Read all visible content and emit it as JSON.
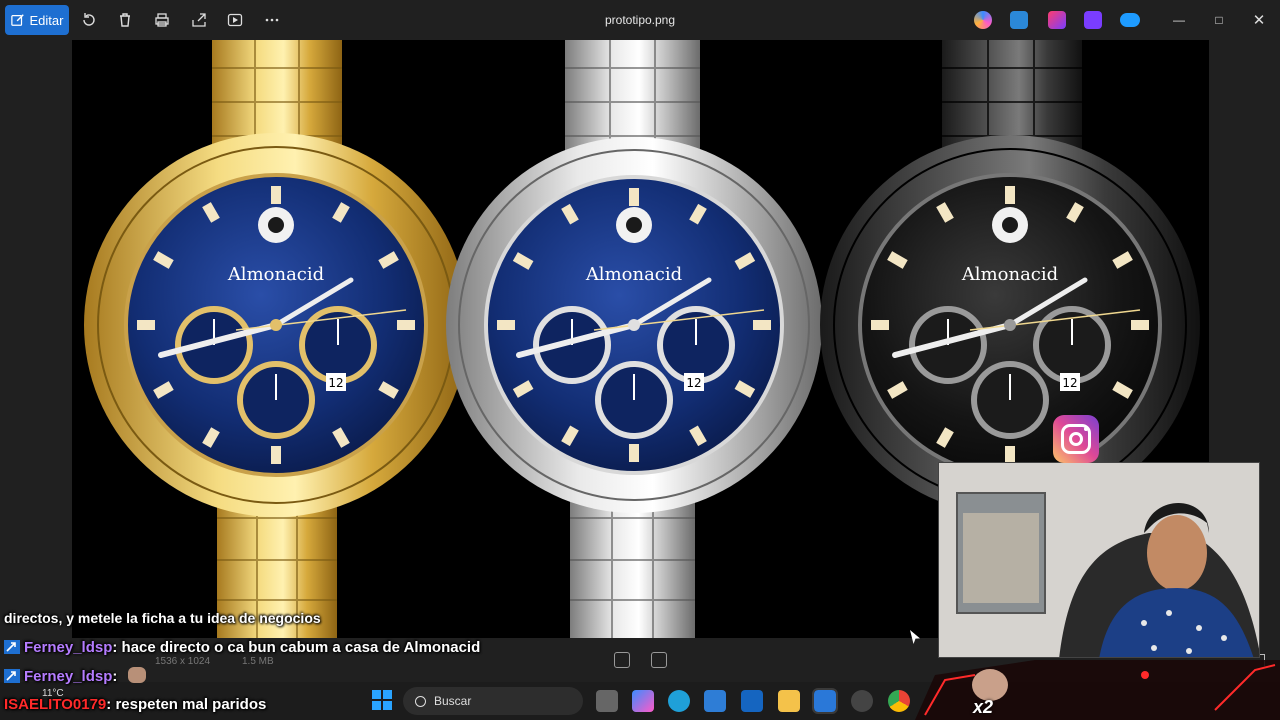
{
  "toolbar": {
    "edit_label": "Editar",
    "title": "prototipo.png"
  },
  "watches": [
    {
      "brand": "Almonacid",
      "finish": "gold",
      "date": "12"
    },
    {
      "brand": "Almonacid",
      "finish": "silver",
      "date": "12"
    },
    {
      "brand": "Almonacid",
      "finish": "black",
      "date": "12"
    }
  ],
  "chat": {
    "line1": "directos, y metele la ficha a tu idea de negocios",
    "messages": [
      {
        "user": "Ferney_ldsp",
        "text": ": hace directo o ca bun cabum a casa de Almonacid"
      },
      {
        "user": "Ferney_ldsp",
        "text": ":"
      },
      {
        "user": "ISAELITO0179",
        "text": ": respeten mal paridos"
      }
    ]
  },
  "image_info": {
    "dimensions": "1536 x 1024",
    "size": "1.5 MB"
  },
  "taskbar": {
    "search_placeholder": "Buscar",
    "weather": "11°C"
  },
  "overlay": {
    "multiplier": "x2"
  },
  "colors": {
    "accent": "#1e6fd1",
    "gold": "#d9b44a",
    "dial_blue": "#0f2a6b",
    "purple_user": "#b57cff",
    "red_user": "#ff2a2a"
  }
}
